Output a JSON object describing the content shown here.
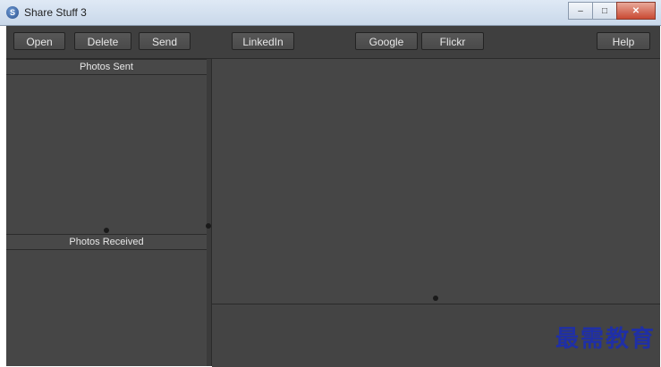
{
  "window": {
    "title": "Share Stuff 3"
  },
  "toolbar": {
    "open_label": "Open",
    "delete_label": "Delete",
    "send_label": "Send",
    "linkedin_label": "LinkedIn",
    "google_label": "Google",
    "flickr_label": "Flickr",
    "help_label": "Help"
  },
  "left_pane": {
    "photos_sent_header": "Photos Sent",
    "photos_received_header": "Photos Received"
  },
  "watermark": "最需教育",
  "colors": {
    "background": "#454545",
    "watermark": "#1f2fa6"
  },
  "icons": [
    "app-icon",
    "minimize-icon",
    "maximize-icon",
    "close-icon"
  ]
}
